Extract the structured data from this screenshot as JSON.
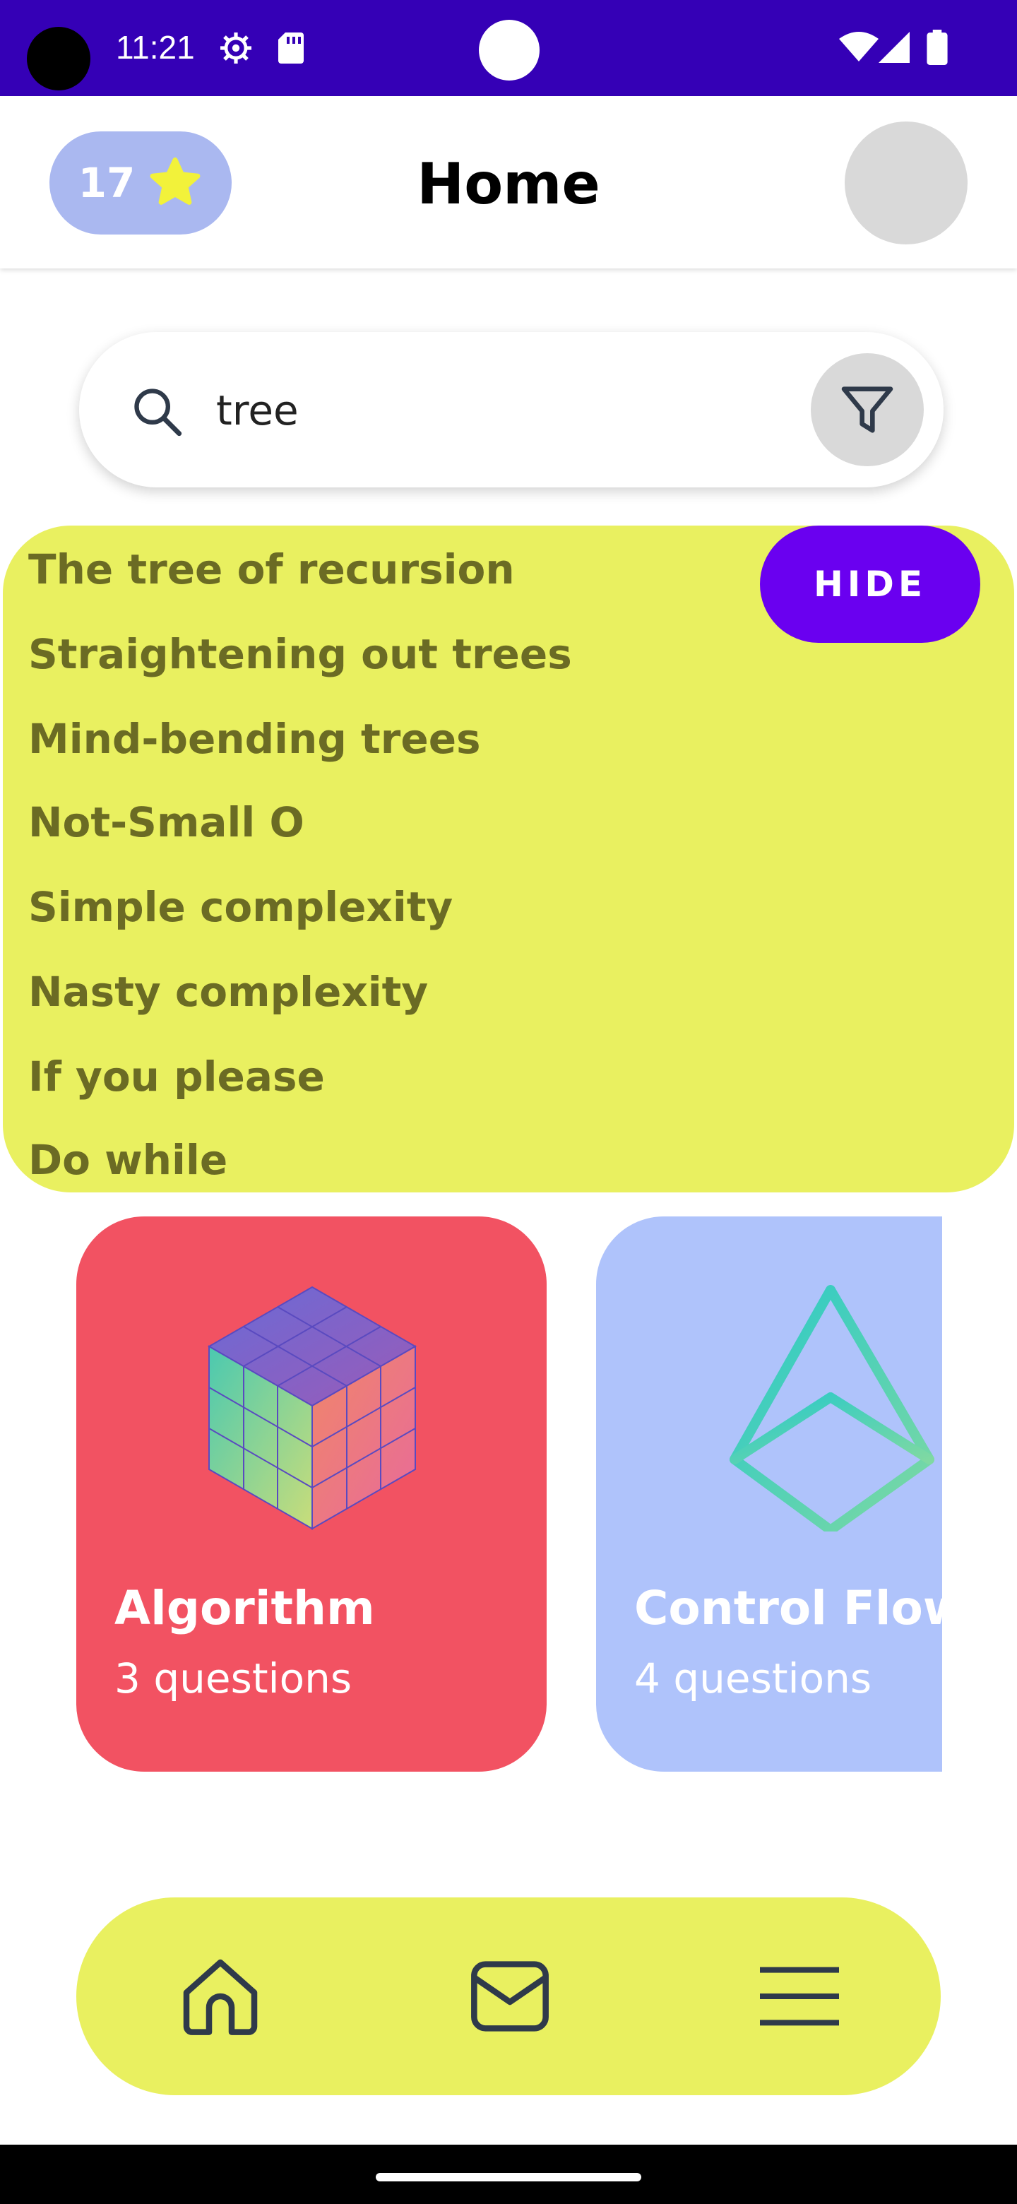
{
  "status_bar": {
    "time": "11:21",
    "icons": [
      "settings-icon",
      "sd-card-icon",
      "wifi-icon",
      "signal-icon",
      "battery-icon"
    ]
  },
  "header": {
    "stars_count": "17",
    "title": "Home"
  },
  "search": {
    "value": "tree"
  },
  "suggestions": {
    "hide_label": "HIDE",
    "items": [
      "The tree of recursion",
      "Straightening out trees",
      "Mind-bending trees",
      "Not-Small O",
      "Simple complexity",
      "Nasty complexity",
      "If you please",
      "Do while"
    ]
  },
  "categories": [
    {
      "title": "Algorithm",
      "subtitle": "3 questions",
      "color": "#f25262",
      "icon": "rubiks-cube-icon"
    },
    {
      "title": "Control Flow",
      "subtitle": "4 questions",
      "color": "#afc3fb",
      "icon": "pyramid-icon"
    }
  ],
  "bottom_nav": {
    "items": [
      "home-icon",
      "mail-icon",
      "menu-icon"
    ]
  },
  "colors": {
    "status_bar": "#3500b6",
    "accent_yellow": "#e9f060",
    "hide_button": "#6a00f0",
    "badge": "#aab8f0"
  }
}
